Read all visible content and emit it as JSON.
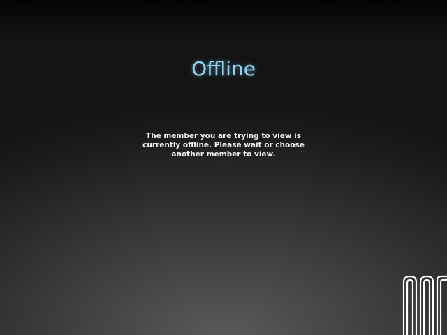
{
  "status": {
    "title": "Offline",
    "message": "The member you are trying to view is currently offline. Please wait or choose another member to view."
  },
  "colors": {
    "title": "#8fd3f0",
    "message": "#f2f2f2",
    "logo": "#ffffff"
  },
  "logo": {
    "icon": "brand-logo-icon"
  }
}
